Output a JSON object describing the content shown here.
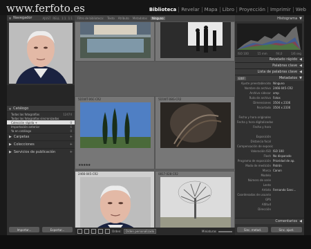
{
  "site": {
    "logo": "www.ferfoto.es"
  },
  "modules": [
    "Biblioteca",
    "Revelar",
    "Mapa",
    "Libro",
    "Proyección",
    "Imprimir",
    "Web"
  ],
  "left": {
    "navigator_title": "Navegador",
    "nav_options": [
      "AJUST",
      "RELL",
      "1:1",
      "1:1"
    ],
    "catalog_title": "Catálogo",
    "catalog_rows": [
      {
        "label": "Todas las fotografías",
        "count": "12474"
      },
      {
        "label": "Todas las fotografías sincronizadas",
        "count": ""
      },
      {
        "label": "Colección rápida +",
        "count": "0"
      },
      {
        "label": "Importación anterior",
        "count": "6"
      },
      {
        "label": "Ya en catálogo",
        "count": "0"
      }
    ],
    "sections": [
      "Carpetas",
      "Colecciones",
      "Servicios de publicación"
    ],
    "import_button": "Importar...",
    "export_button": "Exportar..."
  },
  "center": {
    "filter_label": "Filtro de biblioteca:",
    "filters": [
      "Texto",
      "Atributo",
      "Metadatos",
      "Ninguno"
    ],
    "cells": [
      {
        "meta": "",
        "stars": ""
      },
      {
        "meta": "",
        "stars": ""
      },
      {
        "meta": "5D1WT-06C-CR2",
        "stars": "★★★★★"
      },
      {
        "meta": "5D1WT-08G-CR2",
        "stars": ""
      },
      {
        "meta": "2466-045-CR2",
        "stars": "★★★★★"
      },
      {
        "meta": "0817-028-CR2",
        "stars": ""
      }
    ],
    "sort_label": "Orden:",
    "sort_value": "Orden personalizado",
    "miniaturas": "Miniaturas"
  },
  "right": {
    "histogram_title": "Histograma",
    "hist_info": [
      "ISO 100",
      "15 mm",
      "f/4,0",
      "1/6 seg"
    ],
    "panels": [
      "Revelado rápido",
      "Palabras clave",
      "Lista de palabras clave"
    ],
    "metadata_select": "EXIF",
    "metadata_title": "Metadatos",
    "preset_label": "Ajuste preestablecido",
    "preset_value": "Ninguno",
    "rows": [
      {
        "k": "Nombre de archivo",
        "v": "2466-045-CR2"
      },
      {
        "k": "Archivo sidecar",
        "v": "xmp"
      },
      {
        "k": "Ruta de archivo",
        "v": "Fotos"
      },
      {
        "k": "Dimensiones",
        "v": "3504 x 2336"
      },
      {
        "k": "Recortado",
        "v": "3504 x 2336"
      },
      {
        "k": "",
        "v": ""
      },
      {
        "k": "Fecha y hora originales",
        "v": ""
      },
      {
        "k": "Fecha y hora digitalizadas",
        "v": ""
      },
      {
        "k": "Fecha y hora",
        "v": ""
      },
      {
        "k": "",
        "v": ""
      },
      {
        "k": "Exposición",
        "v": ""
      },
      {
        "k": "Distancia focal",
        "v": ""
      },
      {
        "k": "Compensación de exposición",
        "v": ""
      },
      {
        "k": "Valoración ISO",
        "v": "ISO 100"
      },
      {
        "k": "Flash",
        "v": "No disparado"
      },
      {
        "k": "Programa de exposición",
        "v": "Prioridad de ap."
      },
      {
        "k": "Modo de medición",
        "v": "Patrón"
      },
      {
        "k": "Marca",
        "v": "Canon"
      },
      {
        "k": "Modelo",
        "v": ""
      },
      {
        "k": "Número de serie",
        "v": ""
      },
      {
        "k": "Lente",
        "v": ""
      },
      {
        "k": "Artista",
        "v": "Fernando Sanc..."
      },
      {
        "k": "Coordenadas de usuario",
        "v": ""
      },
      {
        "k": "GPS",
        "v": ""
      },
      {
        "k": "Altitud",
        "v": ""
      },
      {
        "k": "Dirección",
        "v": ""
      }
    ],
    "comments_title": "Comentarios",
    "sync_button": "Sinc. metad.",
    "sync_settings_button": "Sinc. ajust."
  }
}
